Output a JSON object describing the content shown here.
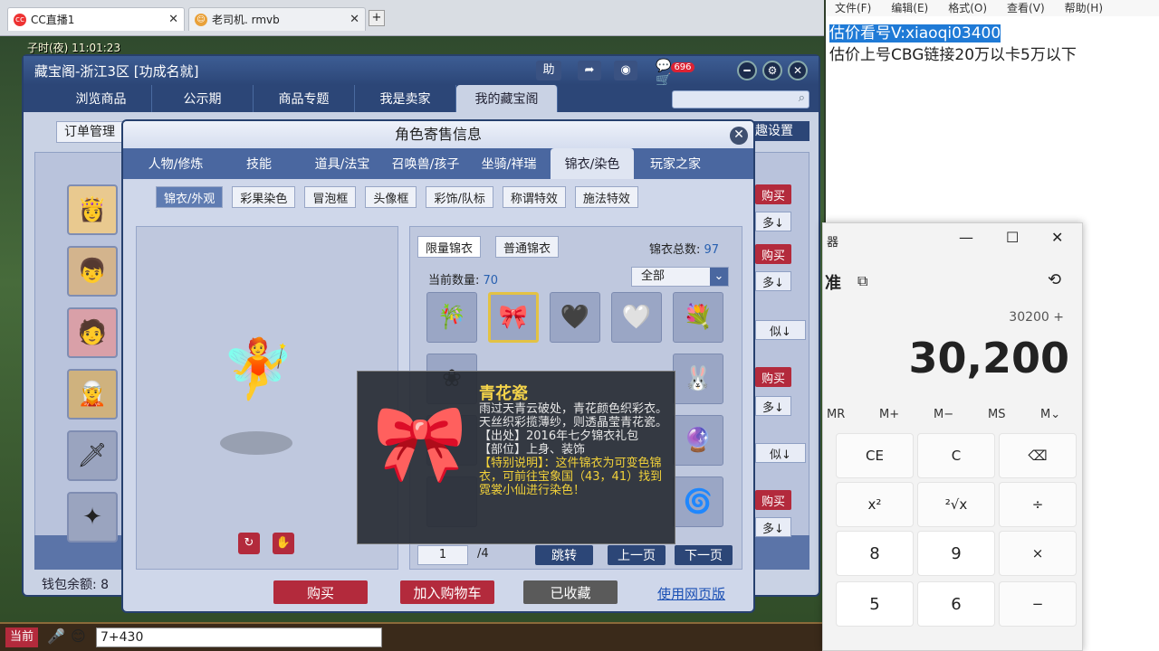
{
  "browser": {
    "tab1": {
      "label": "CC直播1",
      "close": "✕"
    },
    "tab2": {
      "label": "老司机. rmvb",
      "close": "✕"
    },
    "new_tab": "+"
  },
  "game": {
    "clock": "子时(夜)   11:01:23",
    "chat_input": "7+430",
    "chat_button": "当前"
  },
  "shop": {
    "title": "藏宝阁-浙江3区 [功成名就]",
    "help_btn": "助",
    "cart_count": "696",
    "nav_tabs": [
      "浏览商品",
      "公示期",
      "商品专题",
      "我是卖家",
      "我的藏宝阁"
    ],
    "order_btn": "订单管理",
    "interest_btn": "趣设置",
    "wallet": "钱包余额: 8",
    "side_buttons": [
      {
        "buy": "购买",
        "more": "多↓"
      },
      {
        "buy": "购买",
        "more": "多↓",
        "similar": "似↓"
      },
      {
        "buy": "购买",
        "more": "多↓",
        "similar": "似↓"
      },
      {
        "buy": "购买",
        "more": "多↓"
      }
    ]
  },
  "dialog": {
    "title": "角色寄售信息",
    "close": "✕",
    "tabs": [
      "人物/修炼",
      "技能",
      "道具/法宝",
      "召唤兽/孩子",
      "坐骑/祥瑞",
      "锦衣/染色",
      "玩家之家"
    ],
    "subtabs": [
      "锦衣/外观",
      "彩果染色",
      "冒泡框",
      "头像框",
      "彩饰/队标",
      "称谓特效",
      "施法特效"
    ],
    "filter_limited": "限量锦衣",
    "filter_normal": "普通锦衣",
    "total_label": "锦衣总数:",
    "total_value": "97",
    "current_label": "当前数量:",
    "current_value": "70",
    "dropdown": "全部",
    "page_current": "1",
    "page_total": "/4",
    "jump_btn": "跳转",
    "prev_btn": "上一页",
    "next_btn": "下一页",
    "buy_btn": "购买",
    "cart_btn": "加入购物车",
    "fav_btn": "已收藏",
    "web_link": "使用网页版"
  },
  "tooltip": {
    "name": "青花瓷",
    "desc": "雨过天青云破处，青花颜色织彩衣。天丝织彩揽薄纱，则透晶莹青花瓷。",
    "origin": "【出处】2016年七夕锦衣礼包",
    "slot": "【部位】上身、装饰",
    "special": "【特别说明】：这件锦衣为可变色锦衣，可前往宝象国（43，41）找到霓裳小仙进行染色！"
  },
  "notepad": {
    "menu": [
      "文件(F)",
      "编辑(E)",
      "格式(O)",
      "查看(V)",
      "帮助(H)"
    ],
    "line1": "估价看号V:xiaoqi03400",
    "line2": "估价上号CBG链接20万以卡5万以下"
  },
  "calculator": {
    "title_partial": "器",
    "mode": "准",
    "expression": "30200 +",
    "display": "30,200",
    "memory_keys": [
      "MR",
      "M+",
      "M−",
      "MS",
      "M⌄"
    ],
    "keys": [
      "CE",
      "C",
      "⌫",
      "x²",
      "²√x",
      "÷",
      "8",
      "9",
      "×",
      "5",
      "6",
      "−"
    ]
  },
  "colors": {
    "accent": "#2c4677",
    "buy_red": "#b32a3c",
    "tooltip_title": "#f4d34a"
  }
}
